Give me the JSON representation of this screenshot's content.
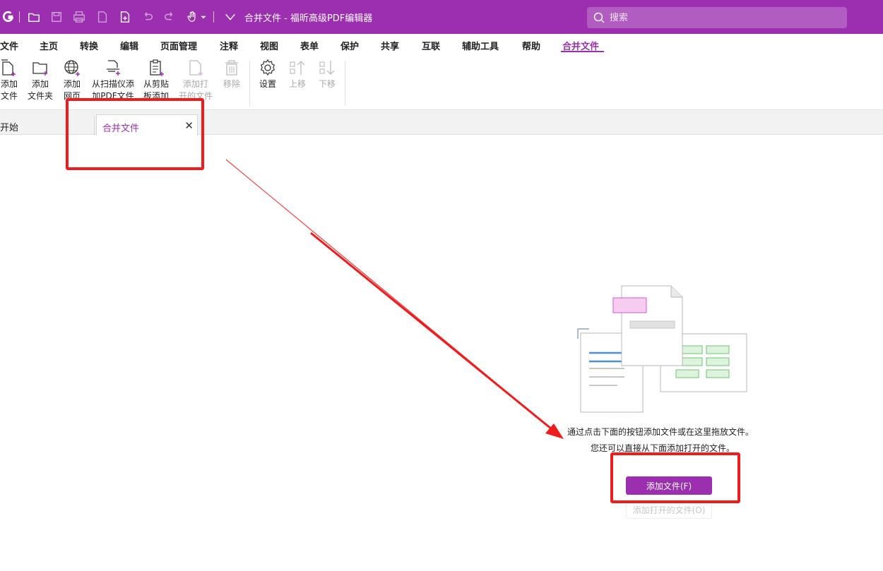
{
  "titlebar": {
    "document_title": "合并文件 - 福昕高级PDF编辑器",
    "search_placeholder": "搜索"
  },
  "menu": {
    "items": [
      "文件",
      "主页",
      "转换",
      "编辑",
      "页面管理",
      "注释",
      "视图",
      "表单",
      "保护",
      "共享",
      "互联",
      "辅助工具",
      "帮助",
      "合并文件"
    ],
    "active": "合并文件"
  },
  "ribbon": {
    "add_file": "添加\n文件",
    "add_folder": "添加\n文件夹",
    "add_webpage": "添加\n网页",
    "add_from_scanner": "从扫描仪添\n加PDF文件",
    "add_from_clipboard": "从剪贴\n板添加",
    "add_open_files": "添加打\n开的文件",
    "remove": "移除",
    "settings": "设置",
    "move_up": "上移",
    "move_down": "下移"
  },
  "tabs": {
    "start": "开始",
    "merge": "合并文件"
  },
  "empty_state": {
    "line1": "通过点击下面的按钮添加文件或在这里拖放文件。",
    "line2": "您还可以直接从下面添加打开的文件。",
    "add_file_button": "添加文件(F)",
    "add_open_files_button": "添加打开的文件(O)"
  },
  "colors": {
    "brand": "#9b2fb0",
    "annotation": "#ee1c1c"
  },
  "icons": [
    "foxit-logo-icon",
    "open-folder-icon",
    "save-icon",
    "print-icon",
    "file-icon",
    "new-file-icon",
    "undo-icon",
    "redo-icon",
    "hand-icon",
    "dropdown-icon",
    "search-icon"
  ]
}
